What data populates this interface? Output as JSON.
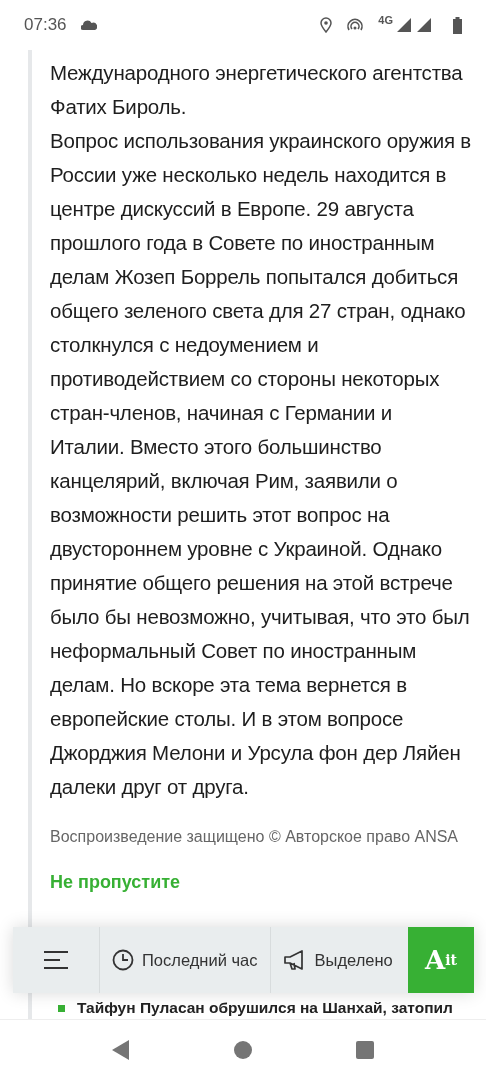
{
  "status_bar": {
    "time": "07:36",
    "network": "4G"
  },
  "article": {
    "paragraphs": [
      "Международного энергетического агентства Фатих Бироль.",
      "Вопрос использования украинского оружия в России уже несколько недель находится в центре дискуссий в Европе. 29 августа прошлого года в Совете по иностранным делам Жозеп Боррель попытался добиться общего зеленого света для 27 стран, однако столкнулся с недоумением и противодействием со стороны некоторых стран-членов, начиная с Германии и Италии. Вместо этого большинство канцелярий, включая Рим, заявили о возможности решить этот вопрос на двустороннем уровне с Украиной. Однако принятие общего решения на этой встрече было бы невозможно, учитывая, что это был неформальный Совет по иностранным делам. Но вскоре эта тема вернется в европейские столы. И в этом вопросе Джорджия Мелони и Урсула фон дер Ляйен далеки друг от друга."
    ],
    "copyright": "Воспроизведение защищено © Авторское право ANSA"
  },
  "related": {
    "title": "Не пропустите",
    "items": [
      "Тайфун Пуласан обрушился на Шанхай, затопил"
    ]
  },
  "bottom_bar": {
    "items": [
      {
        "kind": "menu"
      },
      {
        "kind": "clock",
        "label": "Последний час"
      },
      {
        "kind": "megaphone",
        "label": "Выделено"
      },
      {
        "kind": "logo",
        "label": "A",
        "sup": "it"
      }
    ]
  }
}
